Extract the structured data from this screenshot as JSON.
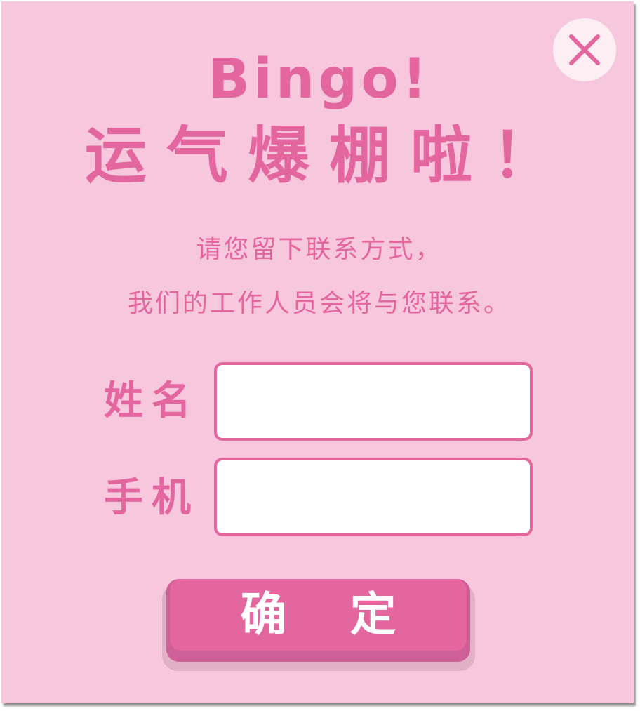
{
  "dialog": {
    "title_en": "Bingo!",
    "title_cn": "运气爆棚啦！",
    "subtitle_line1": "请您留下联系方式，",
    "subtitle_line2": "我们的工作人员会将与您联系。",
    "close_icon": "close-icon"
  },
  "form": {
    "name_label": "姓名",
    "name_value": "",
    "phone_label": "手机",
    "phone_value": ""
  },
  "actions": {
    "confirm_label": "确定"
  },
  "colors": {
    "background": "#f7c8dd",
    "accent": "#e4669f",
    "button_depth": "#cf5f97",
    "close_bg": "#fdeef4",
    "input_bg": "#ffffff"
  }
}
